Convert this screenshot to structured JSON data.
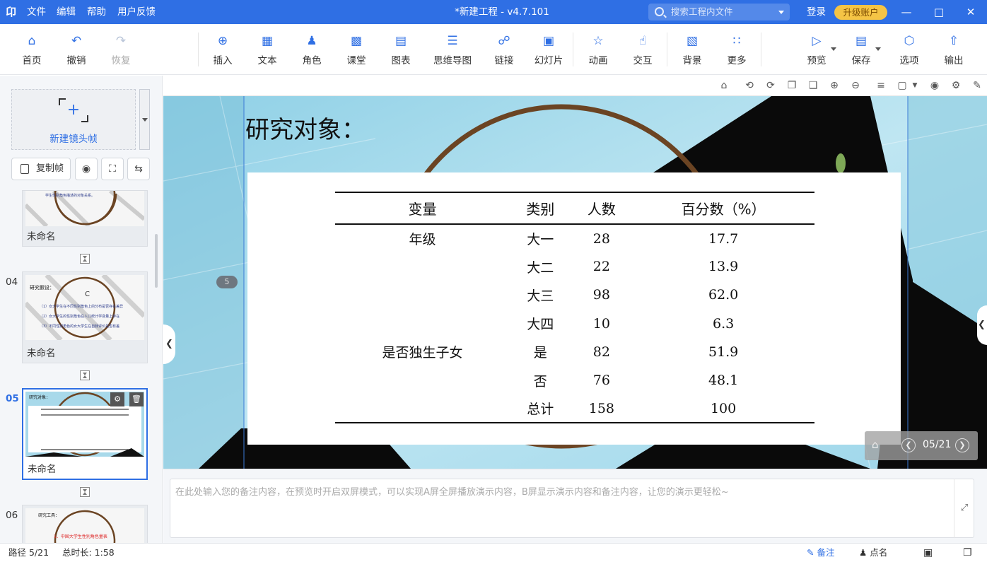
{
  "titlebar": {
    "logo": "卬",
    "menus": [
      "文件",
      "编辑",
      "帮助",
      "用户反馈"
    ],
    "doc_title": "*新建工程 - v4.7.101",
    "search_placeholder": "搜索工程内文件",
    "login": "登录",
    "upgrade": "升级账户"
  },
  "toolbar": {
    "items": [
      {
        "label": "首页",
        "icon": "home-icon"
      },
      {
        "label": "撤销",
        "icon": "undo-icon"
      },
      {
        "label": "恢复",
        "icon": "redo-icon",
        "disabled": true
      },
      {
        "label": "插入",
        "icon": "insert-icon"
      },
      {
        "label": "文本",
        "icon": "text-icon"
      },
      {
        "label": "角色",
        "icon": "character-icon"
      },
      {
        "label": "课堂",
        "icon": "classroom-icon"
      },
      {
        "label": "图表",
        "icon": "chart-icon"
      },
      {
        "label": "思维导图",
        "icon": "mindmap-icon"
      },
      {
        "label": "链接",
        "icon": "link-icon"
      },
      {
        "label": "幻灯片",
        "icon": "slide-icon"
      },
      {
        "label": "动画",
        "icon": "animation-icon"
      },
      {
        "label": "交互",
        "icon": "interaction-icon"
      },
      {
        "label": "背景",
        "icon": "background-icon"
      },
      {
        "label": "更多",
        "icon": "more-icon"
      },
      {
        "label": "预览",
        "icon": "preview-icon"
      },
      {
        "label": "保存",
        "icon": "save-icon"
      },
      {
        "label": "选项",
        "icon": "options-icon"
      },
      {
        "label": "输出",
        "icon": "export-icon"
      }
    ]
  },
  "left_panel": {
    "new_frame_label": "新建镜头帧",
    "copy_frame_label": "复制帧",
    "frames": [
      {
        "number": "",
        "name": "未命名"
      },
      {
        "number": "04",
        "name": "未命名"
      },
      {
        "number": "05",
        "name": "未命名",
        "active": true
      },
      {
        "number": "06",
        "name": ""
      }
    ]
  },
  "slide": {
    "title": "研究对象：",
    "frame_badge": "5",
    "table": {
      "headers": [
        "变量",
        "类别",
        "人数",
        "百分数（%）"
      ],
      "rows": [
        [
          "年级",
          "大一",
          "28",
          "17.7"
        ],
        [
          "",
          "大二",
          "22",
          "13.9"
        ],
        [
          "",
          "大三",
          "98",
          "62.0"
        ],
        [
          "",
          "大四",
          "10",
          "6.3"
        ],
        [
          "是否独生子女",
          "是",
          "82",
          "51.9"
        ],
        [
          "",
          "否",
          "76",
          "48.1"
        ],
        [
          "",
          "总计",
          "158",
          "100"
        ]
      ]
    }
  },
  "nav": {
    "count": "05/21"
  },
  "notes": {
    "placeholder": "在此处输入您的备注内容，在预览时开启双屏模式，可以实现A屏全屏播放演示内容，B屏显示演示内容和备注内容，让您的演示更轻松~"
  },
  "status": {
    "path": "路径 5/21",
    "duration": "总时长: 1:58",
    "notes_btn": "备注",
    "rollcall_btn": "点名"
  },
  "colors": {
    "accent": "#2f6fe4",
    "upgrade": "#f5c445",
    "stage_bg": "#a8d9ea",
    "circle": "#6b4423"
  }
}
